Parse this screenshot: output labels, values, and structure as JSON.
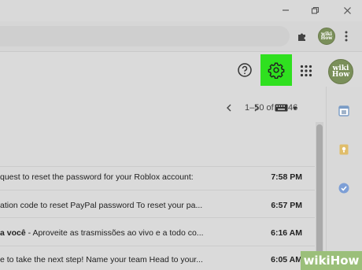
{
  "browser": {
    "avatar_text": "wiki How",
    "icons": [
      "minimize-icon",
      "restore-icon",
      "close-icon",
      "extensions-icon",
      "kebab-menu-icon"
    ]
  },
  "toolbar": {
    "help_icon": "help-icon",
    "settings_icon": "gear-icon",
    "apps_icon": "apps-grid-icon",
    "account_avatar_text": "wiki How",
    "highlight_color": "#2fe01f"
  },
  "pagination": {
    "range": "1–50 of 5,046",
    "prev_icon": "chevron-left-icon",
    "next_icon": "chevron-right-icon",
    "input_tools_icon": "keyboard-icon"
  },
  "emails": [
    {
      "subject_bold": "",
      "subject": "quest to reset the password for your Roblox account:",
      "time": "7:58 PM"
    },
    {
      "subject_bold": "",
      "subject": "ation code to reset PayPal password To reset your pa...",
      "time": "6:57 PM"
    },
    {
      "subject_bold": "a você",
      "subject": " - Aproveite as trasmissões ao vivo e a todo co...",
      "time": "6:16 AM"
    },
    {
      "subject_bold": "",
      "subject": "e to take the next step! Name your team Head to your...",
      "time": "6:05 AM"
    }
  ],
  "side_panel": {
    "icons": [
      "calendar-icon",
      "keep-icon",
      "tasks-icon"
    ]
  },
  "watermark": {
    "text": "wikiHow"
  }
}
